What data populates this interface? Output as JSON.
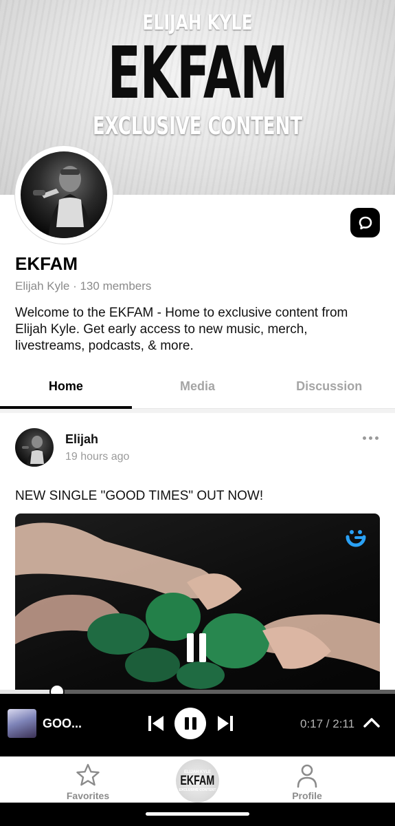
{
  "banner": {
    "line1": "ELIJAH KYLE",
    "line2": "EKFAM",
    "line3": "EXCLUSIVE CONTENT"
  },
  "group": {
    "title": "EKFAM",
    "meta": "Elijah Kyle · 130 members",
    "description": "Welcome to the EKFAM - Home to exclusive content from Elijah Kyle. Get early access to new music, merch, livestreams, podcasts, & more.",
    "chat_icon": "chat-bubble-icon"
  },
  "tabs": [
    {
      "label": "Home",
      "active": true
    },
    {
      "label": "Media",
      "active": false
    },
    {
      "label": "Discussion",
      "active": false
    }
  ],
  "post": {
    "author": "Elijah",
    "time": "19 hours ago",
    "text": "NEW SINGLE \"GOOD TIMES\" OUT NOW!",
    "video_state_icon": "pause-icon"
  },
  "player": {
    "title": "GOO...",
    "time": "0:17 / 2:11",
    "progress": 0.145,
    "state": "playing"
  },
  "nav": {
    "favorites": "Favorites",
    "center_small": "ELIJAH KYLE",
    "center_big": "EKFAM",
    "center_sub": "EXCLUSIVE CONTENT",
    "profile": "Profile"
  },
  "colors": {
    "accent": "#000000",
    "muted_text": "#8a8a8a",
    "badge_blue": "#2aa1f5"
  }
}
